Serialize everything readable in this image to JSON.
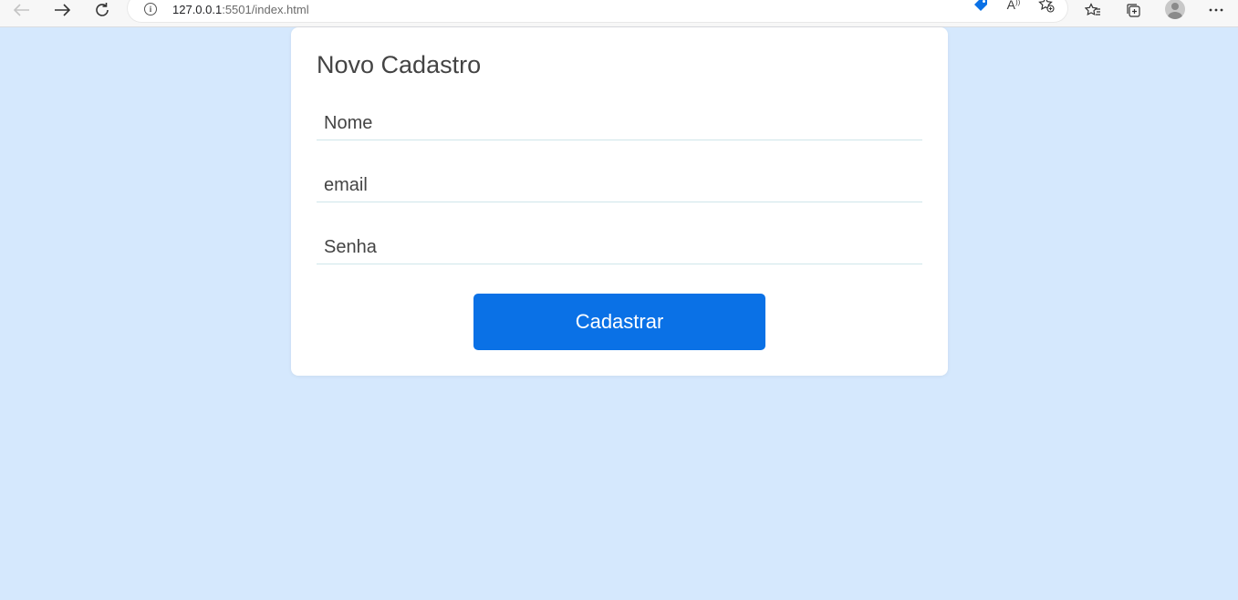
{
  "browser": {
    "url_host": "127.0.0.1",
    "url_rest": ":5501/index.html",
    "icons": [
      "back-arrow-icon",
      "forward-arrow-icon",
      "refresh-icon",
      "info-icon",
      "coupon-tag-icon",
      "read-aloud-icon",
      "add-favorite-icon",
      "favorites-icon",
      "collections-icon",
      "profile-avatar",
      "more-menu-icon"
    ],
    "read_aloud_label": "A",
    "accent_color": "#0a71e6"
  },
  "form": {
    "title": "Novo Cadastro",
    "name_placeholder": "Nome",
    "email_placeholder": "email",
    "password_placeholder": "Senha",
    "submit_label": "Cadastrar"
  },
  "colors": {
    "background": "#d5e8fd",
    "card": "#ffffff",
    "button": "#0a71e6"
  }
}
